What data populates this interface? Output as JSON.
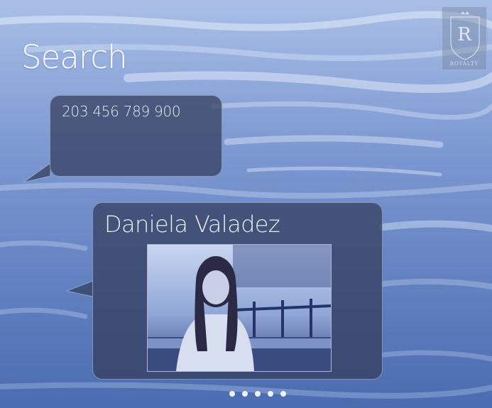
{
  "header": {
    "title": "Search"
  },
  "logo": {
    "initial": "R",
    "text": "ROYALTY"
  },
  "bubbles": {
    "number": {
      "text": "203 456 789 900"
    },
    "contact": {
      "name": "Daniela Valadez"
    }
  },
  "pager": {
    "count": 5,
    "active_index": 0
  },
  "colors": {
    "background": "#5e7fbf",
    "bubble": "#323c5a",
    "text": "#ffffff"
  }
}
